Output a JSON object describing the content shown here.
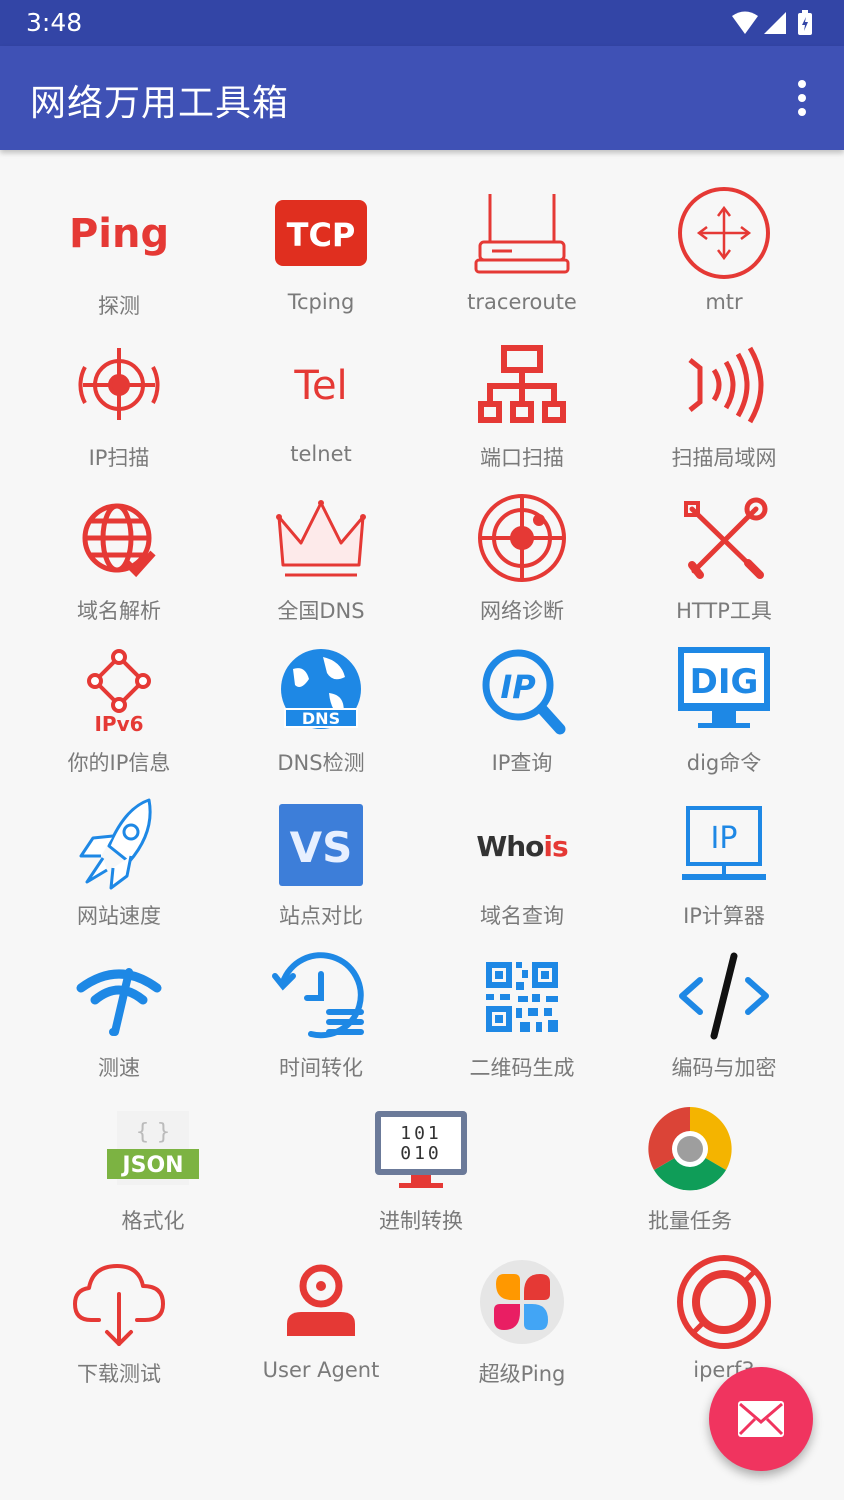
{
  "status_bar": {
    "time": "3:48"
  },
  "app_bar": {
    "title": "网络万用工具箱"
  },
  "tools": [
    {
      "label": "探测",
      "icon": "ping-text-icon",
      "icon_text": "Ping"
    },
    {
      "label": "Tcping",
      "icon": "tcp-badge-icon",
      "icon_text": "TCP"
    },
    {
      "label": "traceroute",
      "icon": "router-icon"
    },
    {
      "label": "mtr",
      "icon": "compass-arrows-icon"
    },
    {
      "label": "IP扫描",
      "icon": "target-scan-icon"
    },
    {
      "label": "telnet",
      "icon": "tel-text-icon",
      "icon_text": "Tel"
    },
    {
      "label": "端口扫描",
      "icon": "network-tree-icon"
    },
    {
      "label": "扫描局域网",
      "icon": "signal-waves-icon"
    },
    {
      "label": "域名解析",
      "icon": "globe-check-icon"
    },
    {
      "label": "全国DNS",
      "icon": "crown-icon"
    },
    {
      "label": "网络诊断",
      "icon": "crosshair-icon"
    },
    {
      "label": "HTTP工具",
      "icon": "tools-cross-icon"
    },
    {
      "label": "你的IP信息",
      "icon": "ipv6-nodes-icon",
      "icon_text": "IPv6"
    },
    {
      "label": "DNS检测",
      "icon": "dns-globe-icon",
      "icon_text": "DNS"
    },
    {
      "label": "IP查询",
      "icon": "ip-magnifier-icon",
      "icon_text": "IP"
    },
    {
      "label": "dig命令",
      "icon": "dig-monitor-icon",
      "icon_text": "DIG"
    },
    {
      "label": "网站速度",
      "icon": "rocket-icon"
    },
    {
      "label": "站点对比",
      "icon": "vs-badge-icon",
      "icon_text": "VS"
    },
    {
      "label": "域名查询",
      "icon": "whois-text-icon",
      "icon_text_a": "Who",
      "icon_text_b": "is"
    },
    {
      "label": "IP计算器",
      "icon": "ip-monitor-icon",
      "icon_text": "IP"
    },
    {
      "label": "测速",
      "icon": "wifi-gauge-icon"
    },
    {
      "label": "时间转化",
      "icon": "clock-history-icon"
    },
    {
      "label": "二维码生成",
      "icon": "qr-code-icon"
    },
    {
      "label": "编码与加密",
      "icon": "code-brackets-icon"
    },
    {
      "label": "格式化",
      "icon": "json-file-icon",
      "icon_text": "JSON",
      "icon_text_top": "{ }"
    },
    {
      "label": "进制转换",
      "icon": "binary-monitor-icon",
      "icon_text_a": "101",
      "icon_text_b": "010"
    },
    {
      "label": "批量任务",
      "icon": "chrome-icon"
    },
    {
      "label": "下载测试",
      "icon": "cloud-download-icon"
    },
    {
      "label": "User Agent",
      "icon": "user-icon"
    },
    {
      "label": "超级Ping",
      "icon": "petals-icon"
    },
    {
      "label": "iperf3",
      "icon": "ring-icon"
    }
  ],
  "fab": {
    "icon": "mail-icon"
  },
  "colors": {
    "status_bar": "#3345a6",
    "app_bar": "#3f51b5",
    "accent_red": "#e53935",
    "icon_blue": "#1e88e5",
    "fab": "#f0345f",
    "label": "#7a7a7a"
  }
}
